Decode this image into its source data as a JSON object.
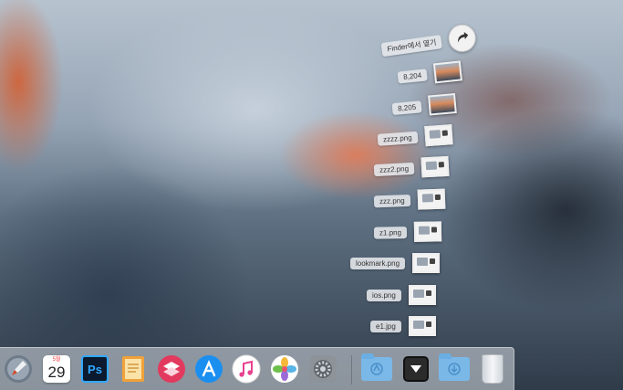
{
  "stack": {
    "open_in_finder_label": "Finder에서 열기",
    "items": [
      {
        "label": "8,204",
        "thumb": "photo"
      },
      {
        "label": "8,205",
        "thumb": "photo"
      },
      {
        "label": "zzzz.png",
        "thumb": "ui"
      },
      {
        "label": "zzz2.png",
        "thumb": "ui"
      },
      {
        "label": "zzz.png",
        "thumb": "ui"
      },
      {
        "label": "z1.png",
        "thumb": "ui"
      },
      {
        "label": "lookmark.png",
        "thumb": "ui"
      },
      {
        "label": "ios.png",
        "thumb": "ui"
      },
      {
        "label": "e1.jpg",
        "thumb": "ui"
      }
    ]
  },
  "dock": {
    "calendar": {
      "month": "5월",
      "day": "29"
    },
    "photoshop_label": "Ps",
    "apps": [
      "launchpad-icon",
      "calendar-icon",
      "photoshop-icon",
      "notes-icon",
      "copy-icon",
      "app-store-icon",
      "itunes-icon",
      "photos-icon",
      "system-preferences-icon"
    ],
    "right": [
      "applications-folder-icon",
      "stack-toggle-icon",
      "downloads-folder-icon",
      "trash-icon"
    ]
  }
}
